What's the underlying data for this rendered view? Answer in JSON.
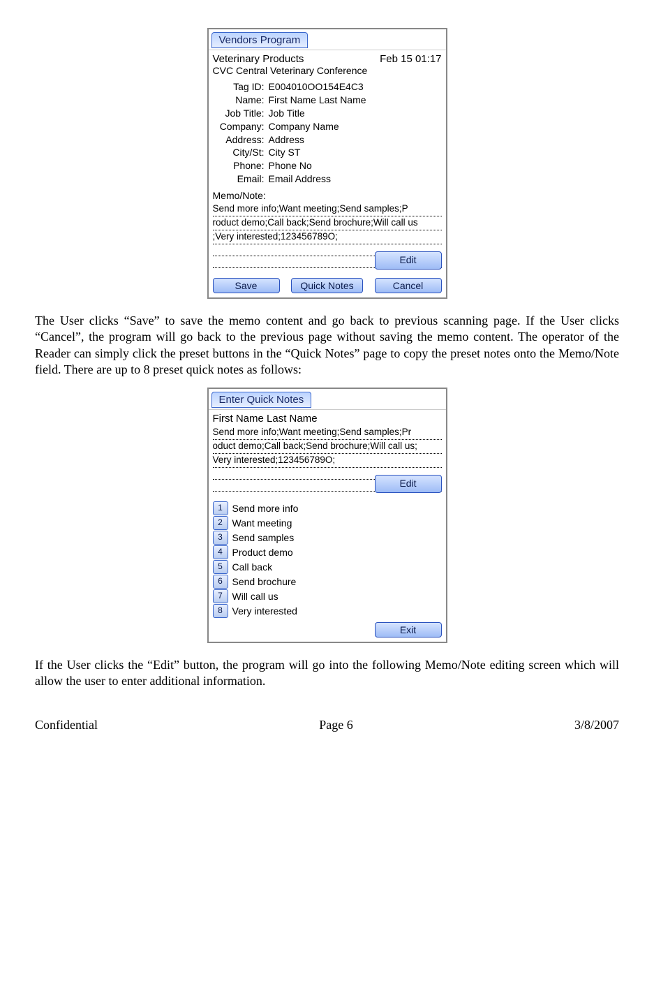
{
  "screen1": {
    "tab": "Vendors Program",
    "header_left": "Veterinary Products",
    "header_right": "Feb 15  01:17",
    "subheader": "CVC Central Veterinary Conference",
    "fields": [
      {
        "label": "Tag ID:",
        "value": "E004010OO154E4C3"
      },
      {
        "label": "Name:",
        "value": "First Name Last Name"
      },
      {
        "label": "Job Title:",
        "value": "Job Title"
      },
      {
        "label": "Company:",
        "value": "Company Name"
      },
      {
        "label": "Address:",
        "value": "Address"
      },
      {
        "label": "City/St:",
        "value": "City ST"
      },
      {
        "label": "Phone:",
        "value": "Phone No"
      },
      {
        "label": "Email:",
        "value": "Email Address"
      }
    ],
    "memo_label": "Memo/Note:",
    "memo_lines": [
      "Send more info;Want meeting;Send samples;P",
      "roduct demo;Call back;Send brochure;Will call us",
      ";Very interested;123456789O;",
      "",
      ""
    ],
    "buttons": {
      "edit": "Edit",
      "save": "Save",
      "quick_notes": "Quick Notes",
      "cancel": "Cancel"
    }
  },
  "para1": "The User clicks “Save” to save the memo content and go back to previous scanning page. If the User clicks “Cancel”,  the program will go back to the previous page without saving the memo content. The operator of the Reader can simply click the preset buttons in the “Quick Notes” page to copy the preset notes onto the Memo/Note field. There are up to 8 preset quick notes as follows:",
  "screen2": {
    "tab": "Enter Quick Notes",
    "name_line": "First Name Last Name",
    "memo_lines": [
      "Send more info;Want meeting;Send samples;Pr",
      "oduct demo;Call back;Send brochure;Will call us;",
      "Very interested;123456789O;",
      "",
      ""
    ],
    "edit_button": "Edit",
    "quick_notes": [
      "Send more info",
      "Want meeting",
      "Send samples",
      "Product demo",
      "Call back",
      "Send brochure",
      "Will call us",
      "Very interested"
    ],
    "exit_button": "Exit"
  },
  "para2": "If the User clicks the “Edit” button, the program  will go into the following Memo/Note editing screen which will allow the user to enter additional information.",
  "footer": {
    "left": "Confidential",
    "center": "Page 6",
    "right": "3/8/2007"
  }
}
